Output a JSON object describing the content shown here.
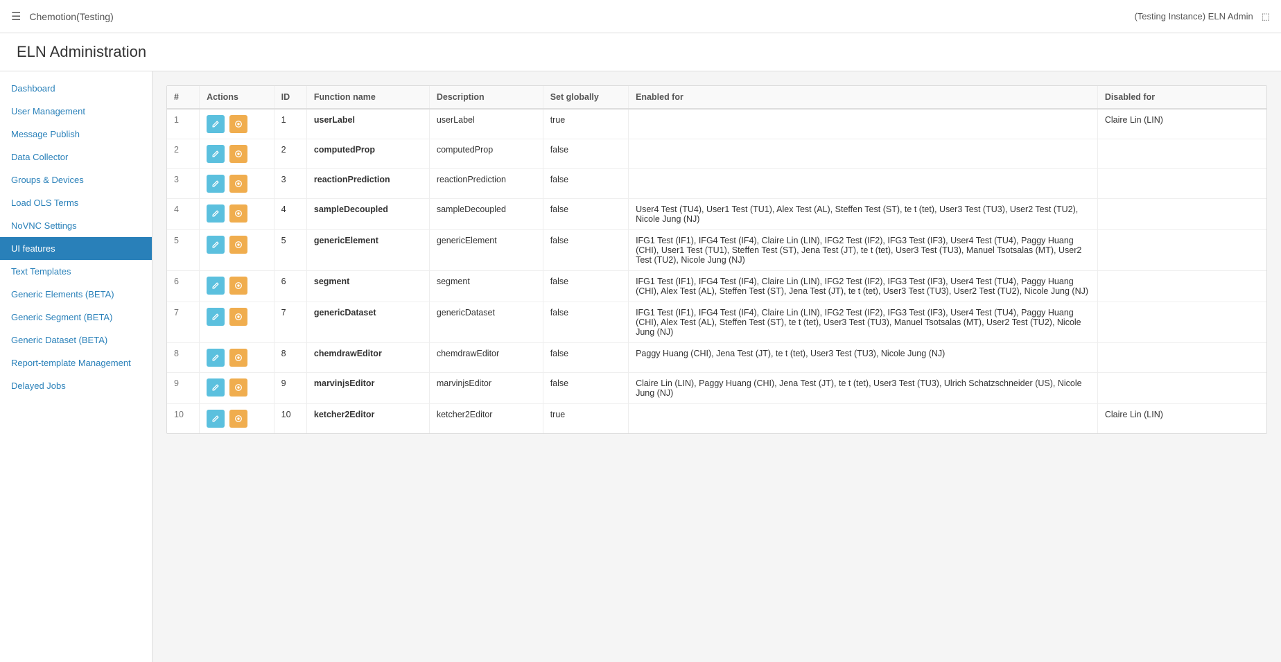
{
  "topbar": {
    "hamburger": "☰",
    "app_title": "Chemotion(Testing)",
    "user_label": "(Testing Instance) ELN Admin",
    "logout_icon": "⬚"
  },
  "page_title": "ELN Administration",
  "sidebar": {
    "items": [
      {
        "id": "dashboard",
        "label": "Dashboard",
        "active": false
      },
      {
        "id": "user-management",
        "label": "User Management",
        "active": false
      },
      {
        "id": "message-publish",
        "label": "Message Publish",
        "active": false
      },
      {
        "id": "data-collector",
        "label": "Data Collector",
        "active": false
      },
      {
        "id": "groups-devices",
        "label": "Groups & Devices",
        "active": false
      },
      {
        "id": "load-ols-terms",
        "label": "Load OLS Terms",
        "active": false
      },
      {
        "id": "novnc-settings",
        "label": "NoVNC Settings",
        "active": false
      },
      {
        "id": "ui-features",
        "label": "UI features",
        "active": true
      },
      {
        "id": "text-templates",
        "label": "Text Templates",
        "active": false
      },
      {
        "id": "generic-elements",
        "label": "Generic Elements (BETA)",
        "active": false
      },
      {
        "id": "generic-segment",
        "label": "Generic Segment (BETA)",
        "active": false
      },
      {
        "id": "generic-dataset",
        "label": "Generic Dataset (BETA)",
        "active": false
      },
      {
        "id": "report-template",
        "label": "Report-template Management",
        "active": false
      },
      {
        "id": "delayed-jobs",
        "label": "Delayed Jobs",
        "active": false
      }
    ]
  },
  "table": {
    "columns": [
      "#",
      "Actions",
      "ID",
      "Function name",
      "Description",
      "Set globally",
      "Enabled for",
      "Disabled for"
    ],
    "rows": [
      {
        "num": "1",
        "id": "1",
        "function_name": "userLabel",
        "description": "userLabel",
        "set_globally": "true",
        "enabled_for": "",
        "disabled_for": "Claire Lin (LIN)"
      },
      {
        "num": "2",
        "id": "2",
        "function_name": "computedProp",
        "description": "computedProp",
        "set_globally": "false",
        "enabled_for": "",
        "disabled_for": ""
      },
      {
        "num": "3",
        "id": "3",
        "function_name": "reactionPrediction",
        "description": "reactionPrediction",
        "set_globally": "false",
        "enabled_for": "",
        "disabled_for": ""
      },
      {
        "num": "4",
        "id": "4",
        "function_name": "sampleDecoupled",
        "description": "sampleDecoupled",
        "set_globally": "false",
        "enabled_for": "User4 Test (TU4), User1 Test (TU1), Alex Test (AL), Steffen Test (ST), te t (tet), User3 Test (TU3), User2 Test (TU2), Nicole Jung (NJ)",
        "disabled_for": ""
      },
      {
        "num": "5",
        "id": "5",
        "function_name": "genericElement",
        "description": "genericElement",
        "set_globally": "false",
        "enabled_for": "IFG1 Test (IF1), IFG4 Test (IF4), Claire Lin (LIN), IFG2 Test (IF2), IFG3 Test (IF3), User4 Test (TU4), Paggy Huang (CHI), User1 Test (TU1), Steffen Test (ST), Jena Test (JT), te t (tet), User3 Test (TU3), Manuel Tsotsalas (MT), User2 Test (TU2), Nicole Jung (NJ)",
        "disabled_for": ""
      },
      {
        "num": "6",
        "id": "6",
        "function_name": "segment",
        "description": "segment",
        "set_globally": "false",
        "enabled_for": "IFG1 Test (IF1), IFG4 Test (IF4), Claire Lin (LIN), IFG2 Test (IF2), IFG3 Test (IF3), User4 Test (TU4), Paggy Huang (CHI), Alex Test (AL), Steffen Test (ST), Jena Test (JT), te t (tet), User3 Test (TU3), User2 Test (TU2), Nicole Jung (NJ)",
        "disabled_for": ""
      },
      {
        "num": "7",
        "id": "7",
        "function_name": "genericDataset",
        "description": "genericDataset",
        "set_globally": "false",
        "enabled_for": "IFG1 Test (IF1), IFG4 Test (IF4), Claire Lin (LIN), IFG2 Test (IF2), IFG3 Test (IF3), User4 Test (TU4), Paggy Huang (CHI), Alex Test (AL), Steffen Test (ST), te t (tet), User3 Test (TU3), Manuel Tsotsalas (MT), User2 Test (TU2), Nicole Jung (NJ)",
        "disabled_for": ""
      },
      {
        "num": "8",
        "id": "8",
        "function_name": "chemdrawEditor",
        "description": "chemdrawEditor",
        "set_globally": "false",
        "enabled_for": "Paggy Huang (CHI), Jena Test (JT), te t (tet), User3 Test (TU3), Nicole Jung (NJ)",
        "disabled_for": ""
      },
      {
        "num": "9",
        "id": "9",
        "function_name": "marvinjsEditor",
        "description": "marvinjsEditor",
        "set_globally": "false",
        "enabled_for": "Claire Lin (LIN), Paggy Huang (CHI), Jena Test (JT), te t (tet), User3 Test (TU3), Ulrich Schatzschneider (US), Nicole Jung (NJ)",
        "disabled_for": ""
      },
      {
        "num": "10",
        "id": "10",
        "function_name": "ketcher2Editor",
        "description": "ketcher2Editor",
        "set_globally": "true",
        "enabled_for": "",
        "disabled_for": "Claire Lin (LIN)"
      }
    ]
  }
}
